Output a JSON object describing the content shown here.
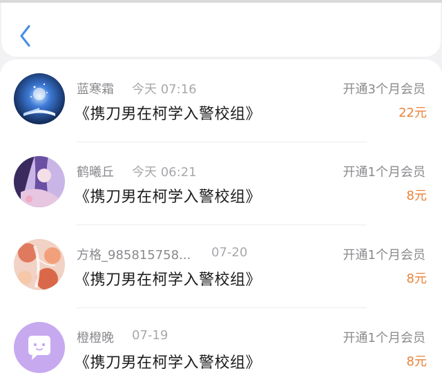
{
  "nav": {
    "back_icon": "chevron-left-icon",
    "accent": "#4a90e2"
  },
  "colors": {
    "price": "#e8833a",
    "name": "#8a8a8e",
    "title": "#1c1c1e"
  },
  "records": [
    {
      "name": "蓝寒霜",
      "time": "今天 07:16",
      "book": "《携刀男在柯学入警校组》",
      "action": "开通3个月会员",
      "price": "22元"
    },
    {
      "name": "鹤曦丘",
      "time": "今天 06:21",
      "book": "《携刀男在柯学入警校组》",
      "action": "开通1个月会员",
      "price": "8元"
    },
    {
      "name": "方格_985815758...",
      "time": "07-20",
      "book": "《携刀男在柯学入警校组》",
      "action": "开通1个月会员",
      "price": "8元"
    },
    {
      "name": "橙橙晚",
      "time": "07-19",
      "book": "《携刀男在柯学入警校组》",
      "action": "开通1个月会员",
      "price": "8元"
    }
  ]
}
